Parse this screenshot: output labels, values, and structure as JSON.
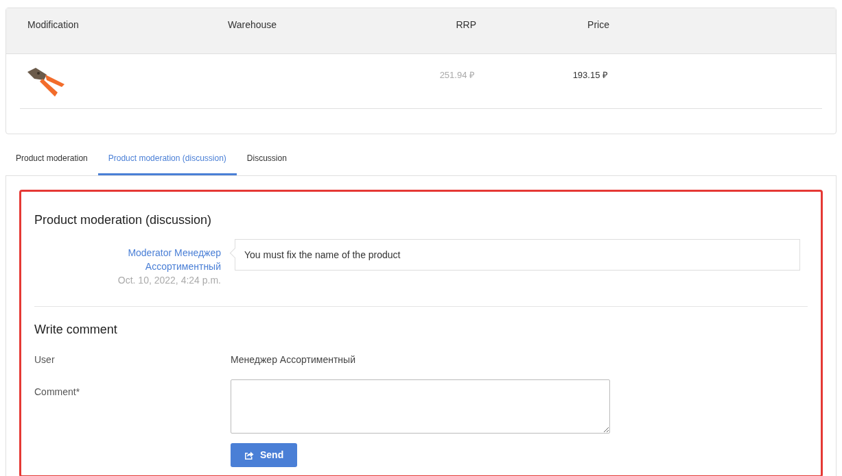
{
  "product_table": {
    "columns": [
      "Modification",
      "Warehouse",
      "RRP",
      "Price"
    ],
    "rows": [
      {
        "rrp": "251.94 ₽",
        "price": "193.15 ₽"
      }
    ]
  },
  "tabs": [
    {
      "label": "Product moderation",
      "selected": false
    },
    {
      "label": "Product moderation (discussion)",
      "selected": true
    },
    {
      "label": "Discussion",
      "selected": false
    }
  ],
  "discussion": {
    "title": "Product moderation (discussion)",
    "comments": [
      {
        "author": "Moderator Менеджер Ассортиментный",
        "date": "Oct. 10, 2022, 4:24 p.m.",
        "text": "You must fix the name of the product"
      }
    ]
  },
  "write_comment": {
    "title": "Write comment",
    "user_label": "User",
    "user_value": "Менеджер Ассортиментный",
    "comment_label": "Comment*",
    "send_button": "Send"
  }
}
